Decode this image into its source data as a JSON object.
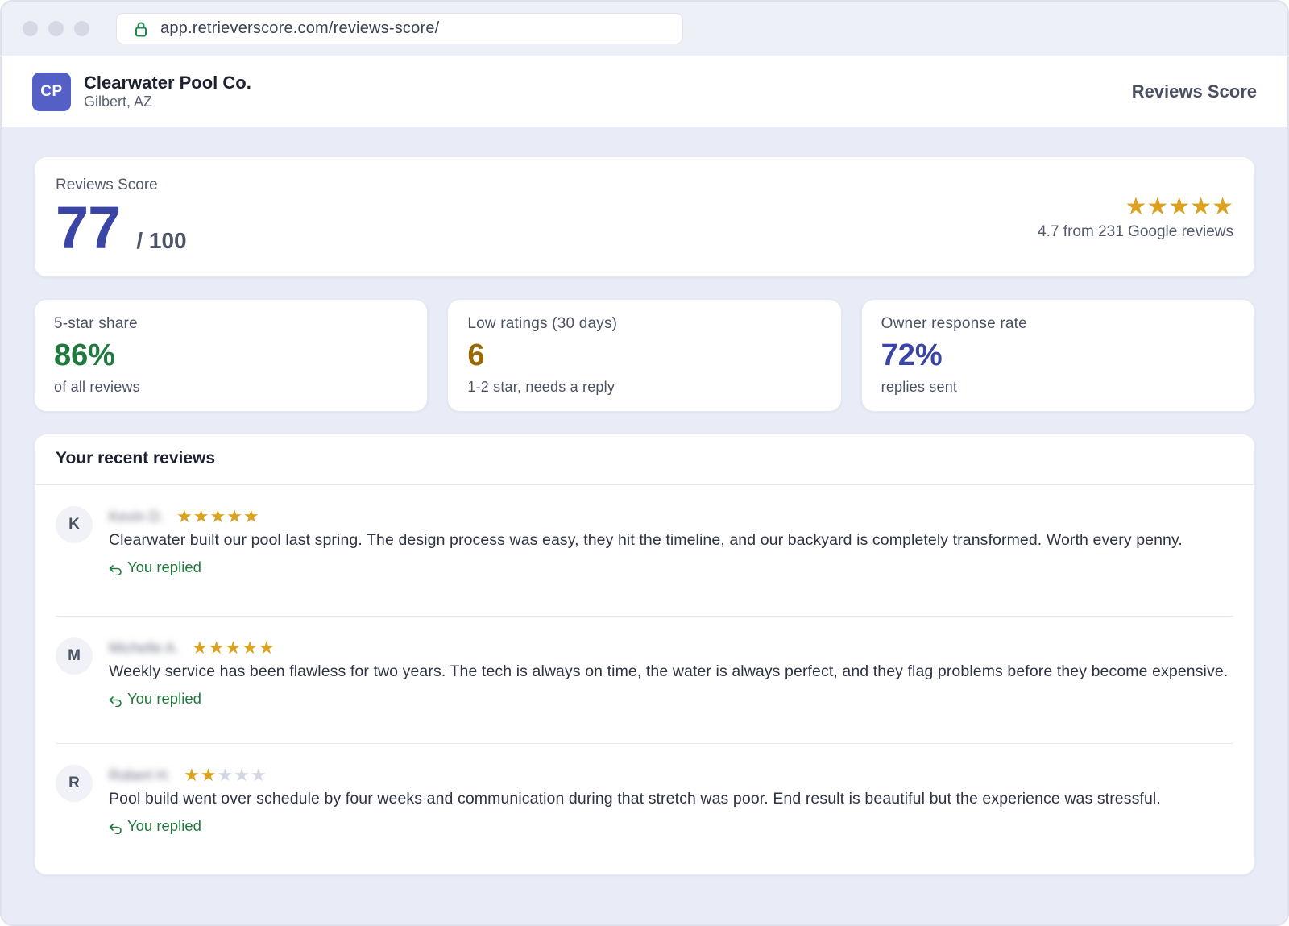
{
  "browser": {
    "url": "app.retrieverscore.com/reviews-score/"
  },
  "header": {
    "logo_initials": "CP",
    "business_name": "Clearwater Pool Co.",
    "location": "Gilbert, AZ",
    "title": "Reviews Score"
  },
  "score": {
    "label": "Reviews Score",
    "value": "77",
    "max": "/ 100",
    "stars": "★★★★★",
    "rating_text": "4.7 from 231 Google reviews"
  },
  "kpis": [
    {
      "label": "5-star share",
      "value": "86%",
      "sub": "of all reviews",
      "color": "#1f7a3e"
    },
    {
      "label": "Low ratings (30 days)",
      "value": "6",
      "sub": "1-2 star, needs a reply",
      "color": "#9a6a00"
    },
    {
      "label": "Owner response rate",
      "value": "72%",
      "sub": "replies sent",
      "color": "#3b45a6"
    }
  ],
  "reviews": {
    "title": "Your recent reviews",
    "items": [
      {
        "initial": "K",
        "name": "Kevin D.",
        "rating": 5,
        "stars_on": "★★★★★",
        "stars_off": "",
        "text": "Clearwater built our pool last spring. The design process was easy, they hit the timeline, and our backyard is completely transformed. Worth every penny.",
        "replied": "You replied"
      },
      {
        "initial": "M",
        "name": "Michelle A.",
        "rating": 5,
        "stars_on": "★★★★★",
        "stars_off": "",
        "text": "Weekly service has been flawless for two years. The tech is always on time, the water is always perfect, and they flag problems before they become expensive.",
        "replied": "You replied"
      },
      {
        "initial": "R",
        "name": "Robert H.",
        "rating": 2,
        "stars_on": "★★",
        "stars_off": "★★★",
        "text": "Pool build went over schedule by four weeks and communication during that stretch was poor. End result is beautiful but the experience was stressful.",
        "replied": "You replied"
      }
    ]
  },
  "colors": {
    "accent": "#3b45a6",
    "logo_bg": "#5560c6",
    "star": "#dba11f",
    "positive": "#1f7a3e"
  }
}
